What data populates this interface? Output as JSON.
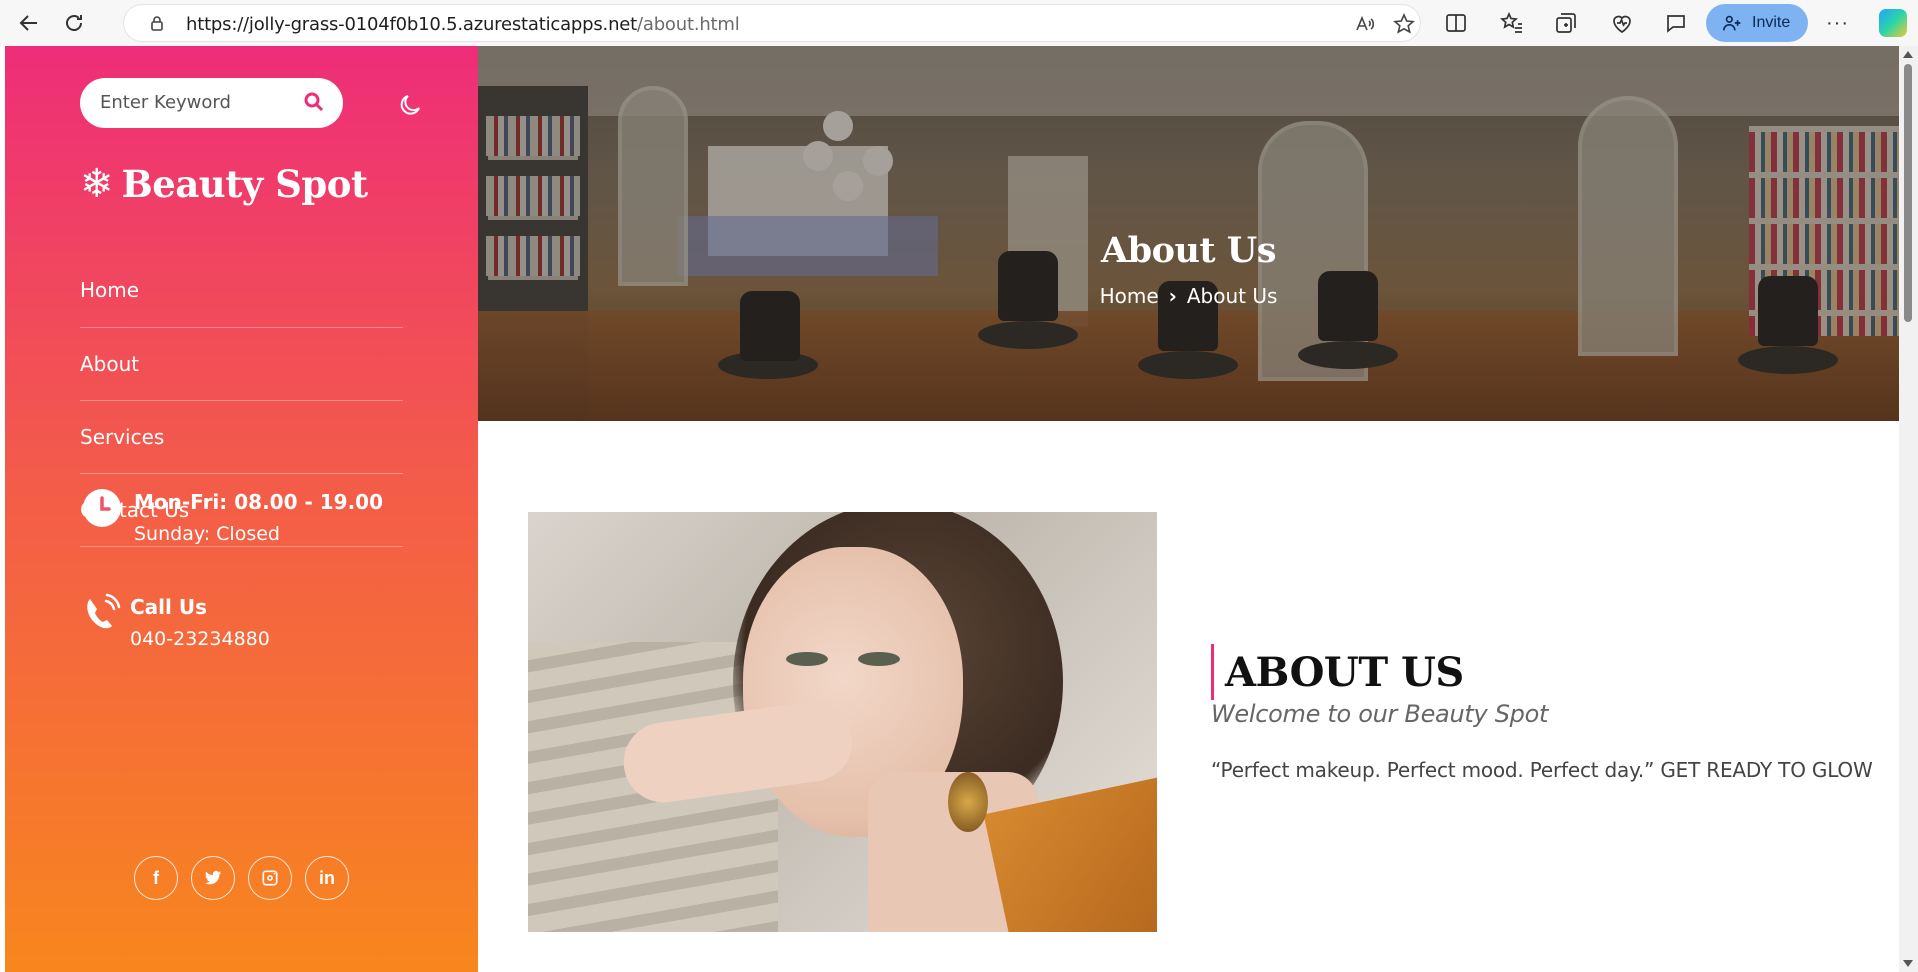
{
  "browser": {
    "url_domain": "https://jolly-grass-0104f0b10.5.azurestaticapps.net",
    "url_path": "/about.html",
    "invite_label": "Invite",
    "more_label": "···"
  },
  "sidebar": {
    "search_placeholder": "Enter Keyword",
    "brand_icon": "❄",
    "brand_name": "Beauty Spot",
    "menu": [
      {
        "label": "Home"
      },
      {
        "label": "About"
      },
      {
        "label": "Services"
      },
      {
        "label": "Contact Us"
      }
    ],
    "hours": {
      "title": "Mon-Fri: 08.00 - 19.00",
      "detail": "Sunday: Closed"
    },
    "phone": {
      "title": "Call Us",
      "detail": "040-23234880"
    },
    "socials": [
      {
        "icon": "facebook-icon",
        "glyph": "f"
      },
      {
        "icon": "twitter-icon",
        "glyph": ""
      },
      {
        "icon": "instagram-icon",
        "glyph": ""
      },
      {
        "icon": "linkedin-icon",
        "glyph": "in"
      }
    ],
    "colors": {
      "top": "#ee2d78",
      "bottom": "#f8861e"
    }
  },
  "hero": {
    "title": "About Us",
    "crumb_home": "Home",
    "crumb_sep": "›",
    "crumb_current": "About Us"
  },
  "about": {
    "heading": "ABOUT US",
    "subheading": "Welcome to our Beauty Spot",
    "body": "“Perfect makeup. Perfect mood. Perfect day.” GET READY TO GLOW",
    "accent": "#ee2d78"
  }
}
